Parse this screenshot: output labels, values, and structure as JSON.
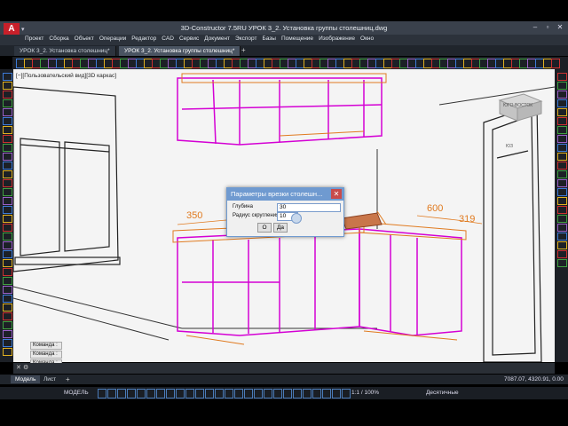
{
  "app": {
    "title": "3D-Constructor 7.5RU      УРОК 3_2. Установка группы столешниц.dwg",
    "logo": "A"
  },
  "menu": [
    "Проект",
    "Сборка",
    "Объект",
    "Операции",
    "Редактор",
    "CAD",
    "Сервис",
    "Документ",
    "Экспорт",
    "Базы",
    "Помещение",
    "Изображение",
    "Окно"
  ],
  "doc_tabs": [
    "УРОК 3_2. Установка столешниц*",
    "УРОК 3_2. Установка группы столешниц*"
  ],
  "viewport_label": "[−][Пользовательский вид][3D каркас]",
  "viewcube": {
    "label": "ЮГО-ВОСТОК",
    "compass": "ЮЗ"
  },
  "drawing": {
    "dims": [
      "350",
      "600",
      "319"
    ]
  },
  "dialog": {
    "title": "Параметры врезки столешн...",
    "fields": [
      {
        "label": "Глубина",
        "value": "30"
      },
      {
        "label": "Радиус скругления",
        "value": "10"
      }
    ],
    "ok_label": "О",
    "yes_label": "Да"
  },
  "command_lines": [
    "Команда :",
    "Команда :",
    "Команда :"
  ],
  "layout_tabs": [
    "Модель",
    "Лист"
  ],
  "coords": "7087.07, 4320.91, 0.00",
  "status": {
    "model": "МОДЕЛЬ",
    "scale": "1:1 / 100%",
    "units": "Десятичные"
  },
  "colors": {
    "cabinet_magenta": "#d400d4",
    "cabinet_orange": "#e07a1f",
    "dialog_title": "#6f9ad0"
  }
}
